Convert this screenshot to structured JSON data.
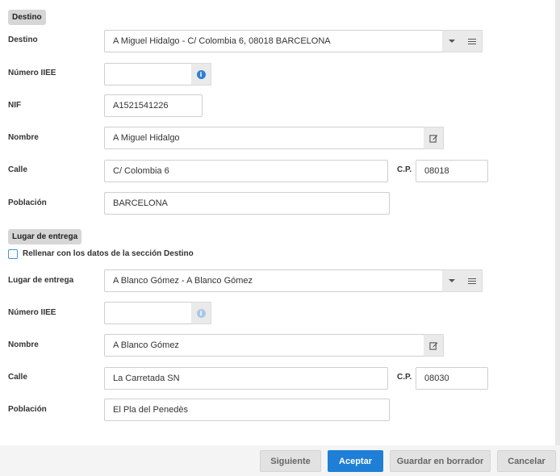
{
  "destino_section": {
    "title": "Destino",
    "destino": {
      "label": "Destino",
      "value": "A Miguel Hidalgo - C/ Colombia 6, 08018 BARCELONA"
    },
    "numero_iiee": {
      "label": "Número IIEE",
      "value": ""
    },
    "nif": {
      "label": "NIF",
      "value": "A1521541226"
    },
    "nombre": {
      "label": "Nombre",
      "value": "A Miguel Hidalgo"
    },
    "calle": {
      "label": "Calle",
      "value": "C/ Colombia 6"
    },
    "cp": {
      "label": "C.P.",
      "value": "08018"
    },
    "poblacion": {
      "label": "Población",
      "value": "BARCELONA"
    }
  },
  "lugar_section": {
    "title": "Lugar de entrega",
    "fill_checkbox_label": "Rellenar con los datos de la sección Destino",
    "lugar": {
      "label": "Lugar de entrega",
      "value": "A Blanco Gómez - A Blanco Gómez"
    },
    "numero_iiee": {
      "label": "Número IIEE",
      "value": ""
    },
    "nombre": {
      "label": "Nombre",
      "value": "A Blanco Gómez"
    },
    "calle": {
      "label": "Calle",
      "value": "La Carretada SN"
    },
    "cp": {
      "label": "C.P.",
      "value": "08030"
    },
    "poblacion": {
      "label": "Población",
      "value": "El Pla del Penedès"
    }
  },
  "footer": {
    "siguiente": "Siguiente",
    "aceptar": "Aceptar",
    "guardar": "Guardar en borrador",
    "cancelar": "Cancelar"
  },
  "colors": {
    "primary": "#1f7fd6",
    "section_bg": "#d6d6d6",
    "addon_bg": "#eaeaea"
  },
  "icons": {
    "select_caret": "chevron-down-icon",
    "select_menu": "list-menu-icon",
    "info": "info-icon",
    "edit": "edit-icon"
  }
}
